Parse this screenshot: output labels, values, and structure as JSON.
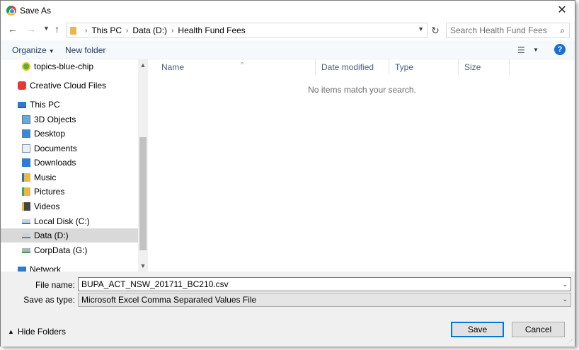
{
  "window": {
    "title": "Save As"
  },
  "nav": {
    "breadcrumbs": [
      "This PC",
      "Data (D:)",
      "Health Fund Fees"
    ],
    "search_placeholder": "Search Health Fund Fees"
  },
  "toolbar": {
    "organize": "Organize",
    "new_folder": "New folder",
    "help": "?"
  },
  "tree": [
    {
      "label": "topics-blue-chip",
      "icon": "topics-icon"
    },
    {
      "label": "Creative Cloud Files",
      "icon": "creative-cloud-icon"
    },
    {
      "label": "This PC",
      "icon": "computer-icon"
    },
    {
      "label": "3D Objects",
      "icon": "3d-objects-icon"
    },
    {
      "label": "Desktop",
      "icon": "desktop-icon"
    },
    {
      "label": "Documents",
      "icon": "documents-icon"
    },
    {
      "label": "Downloads",
      "icon": "downloads-icon"
    },
    {
      "label": "Music",
      "icon": "music-icon"
    },
    {
      "label": "Pictures",
      "icon": "pictures-icon"
    },
    {
      "label": "Videos",
      "icon": "videos-icon"
    },
    {
      "label": "Local Disk (C:)",
      "icon": "local-disk-icon"
    },
    {
      "label": "Data (D:)",
      "icon": "drive-icon",
      "selected": true
    },
    {
      "label": "CorpData (G:)",
      "icon": "network-drive-icon"
    },
    {
      "label": "Network",
      "icon": "network-icon"
    }
  ],
  "columns": [
    "Name",
    "Date modified",
    "Type",
    "Size"
  ],
  "empty_message": "No items match your search.",
  "form": {
    "file_name_label": "File name:",
    "file_name_value": "BUPA_ACT_NSW_201711_BC210.csv",
    "save_type_label": "Save as type:",
    "save_type_value": "Microsoft Excel Comma Separated Values File"
  },
  "footer": {
    "hide_folders": "Hide Folders",
    "save": "Save",
    "cancel": "Cancel"
  }
}
